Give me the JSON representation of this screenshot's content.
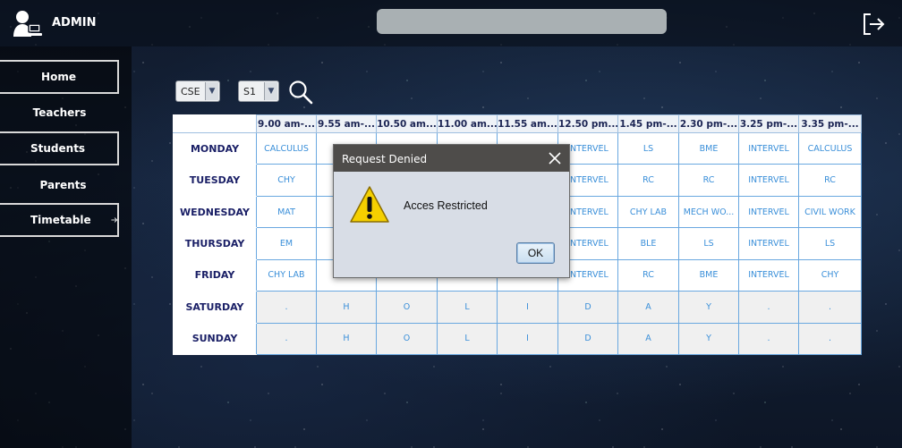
{
  "header": {
    "admin_label": "ADMIN",
    "avatar_icon": "admin-user-icon",
    "logout_icon": "logout-icon"
  },
  "sidebar": {
    "items": [
      {
        "label": "Home",
        "boxed": true
      },
      {
        "label": "Teachers",
        "boxed": false
      },
      {
        "label": "Students",
        "boxed": true
      },
      {
        "label": "Parents",
        "boxed": false
      },
      {
        "label": "Timetable",
        "boxed": true,
        "icon": "arrow-right-icon"
      }
    ]
  },
  "filters": {
    "department": "CSE",
    "semester": "S1",
    "search_icon": "search-icon"
  },
  "timetable": {
    "headers": [
      "9.00 am-...",
      "9.55 am-...",
      "10.50 am...",
      "11.00 am...",
      "11.55 am...",
      "12.50 pm...",
      "1.45 pm-...",
      "2.30 pm-...",
      "3.25 pm-...",
      "3.35 pm-..."
    ],
    "rows": [
      {
        "day": "MONDAY",
        "cells": [
          "CALCULUS",
          "",
          "",
          "",
          "",
          "INTERVEL",
          "LS",
          "BME",
          "INTERVEL",
          "CALCULUS"
        ]
      },
      {
        "day": "TUESDAY",
        "cells": [
          "CHY",
          "",
          "",
          "",
          "",
          "INTERVEL",
          "RC",
          "RC",
          "INTERVEL",
          "RC"
        ]
      },
      {
        "day": "WEDNESDAY",
        "cells": [
          "MAT",
          "",
          "",
          "",
          "",
          "INTERVEL",
          "CHY LAB",
          "MECH WO...",
          "INTERVEL",
          "CIVIL WORK"
        ]
      },
      {
        "day": "THURSDAY",
        "cells": [
          "EM",
          "",
          "",
          "",
          "",
          "INTERVEL",
          "BLE",
          "LS",
          "INTERVEL",
          "LS"
        ]
      },
      {
        "day": "FRIDAY",
        "cells": [
          "CHY LAB",
          "",
          "",
          "",
          "",
          "INTERVEL",
          "RC",
          "BME",
          "INTERVEL",
          "CHY"
        ]
      },
      {
        "day": "SATURDAY",
        "cells": [
          ".",
          "H",
          "O",
          "L",
          "I",
          "D",
          "A",
          "Y",
          ".",
          "."
        ]
      },
      {
        "day": "SUNDAY",
        "cells": [
          ".",
          "H",
          "O",
          "L",
          "I",
          "D",
          "A",
          "Y",
          ".",
          "."
        ]
      }
    ]
  },
  "dialog": {
    "title": "Request Denied",
    "message": "Acces Restricted",
    "ok_label": "OK",
    "icon": "warning-icon"
  }
}
